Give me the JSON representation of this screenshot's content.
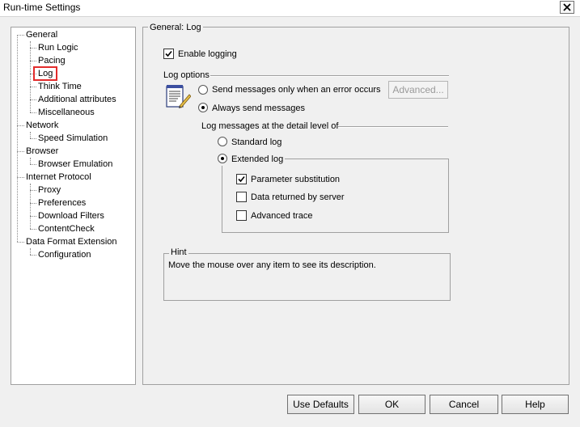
{
  "window": {
    "title": "Run-time Settings"
  },
  "tree": {
    "items": [
      {
        "label": "General"
      },
      {
        "label": "Run Logic"
      },
      {
        "label": "Pacing"
      },
      {
        "label": "Log"
      },
      {
        "label": "Think Time"
      },
      {
        "label": "Additional attributes"
      },
      {
        "label": "Miscellaneous"
      },
      {
        "label": "Network"
      },
      {
        "label": "Speed Simulation"
      },
      {
        "label": "Browser"
      },
      {
        "label": "Browser Emulation"
      },
      {
        "label": "Internet Protocol"
      },
      {
        "label": "Proxy"
      },
      {
        "label": "Preferences"
      },
      {
        "label": "Download Filters"
      },
      {
        "label": "ContentCheck"
      },
      {
        "label": "Data Format Extension"
      },
      {
        "label": "Configuration"
      }
    ],
    "selected": "Log"
  },
  "panel": {
    "title": "General: Log",
    "enable_logging": {
      "label": "Enable logging",
      "checked": true
    },
    "log_options": {
      "title": "Log options",
      "send_on_error": {
        "label": "Send messages only when an error occurs",
        "selected": false
      },
      "always_send": {
        "label": "Always send messages",
        "selected": true
      },
      "advanced_button": "Advanced..."
    },
    "detail_level": {
      "title": "Log messages at the detail level of",
      "standard": {
        "label": "Standard log",
        "selected": false
      },
      "extended": {
        "label": "Extended log",
        "selected": true
      },
      "parameter_substitution": {
        "label": "Parameter substitution",
        "checked": true
      },
      "data_returned": {
        "label": "Data returned by server",
        "checked": false
      },
      "advanced_trace": {
        "label": "Advanced trace",
        "checked": false
      }
    },
    "hint": {
      "title": "Hint",
      "text": "Move the mouse over any item to see its description."
    }
  },
  "buttons": {
    "use_defaults": "Use Defaults",
    "ok": "OK",
    "cancel": "Cancel",
    "help": "Help"
  },
  "icons": {
    "close": "close-icon",
    "log_options": "notepad-pencil-icon"
  },
  "colors": {
    "selection_outline": "#e22b2b",
    "dialog_bg": "#f0f0f0"
  }
}
